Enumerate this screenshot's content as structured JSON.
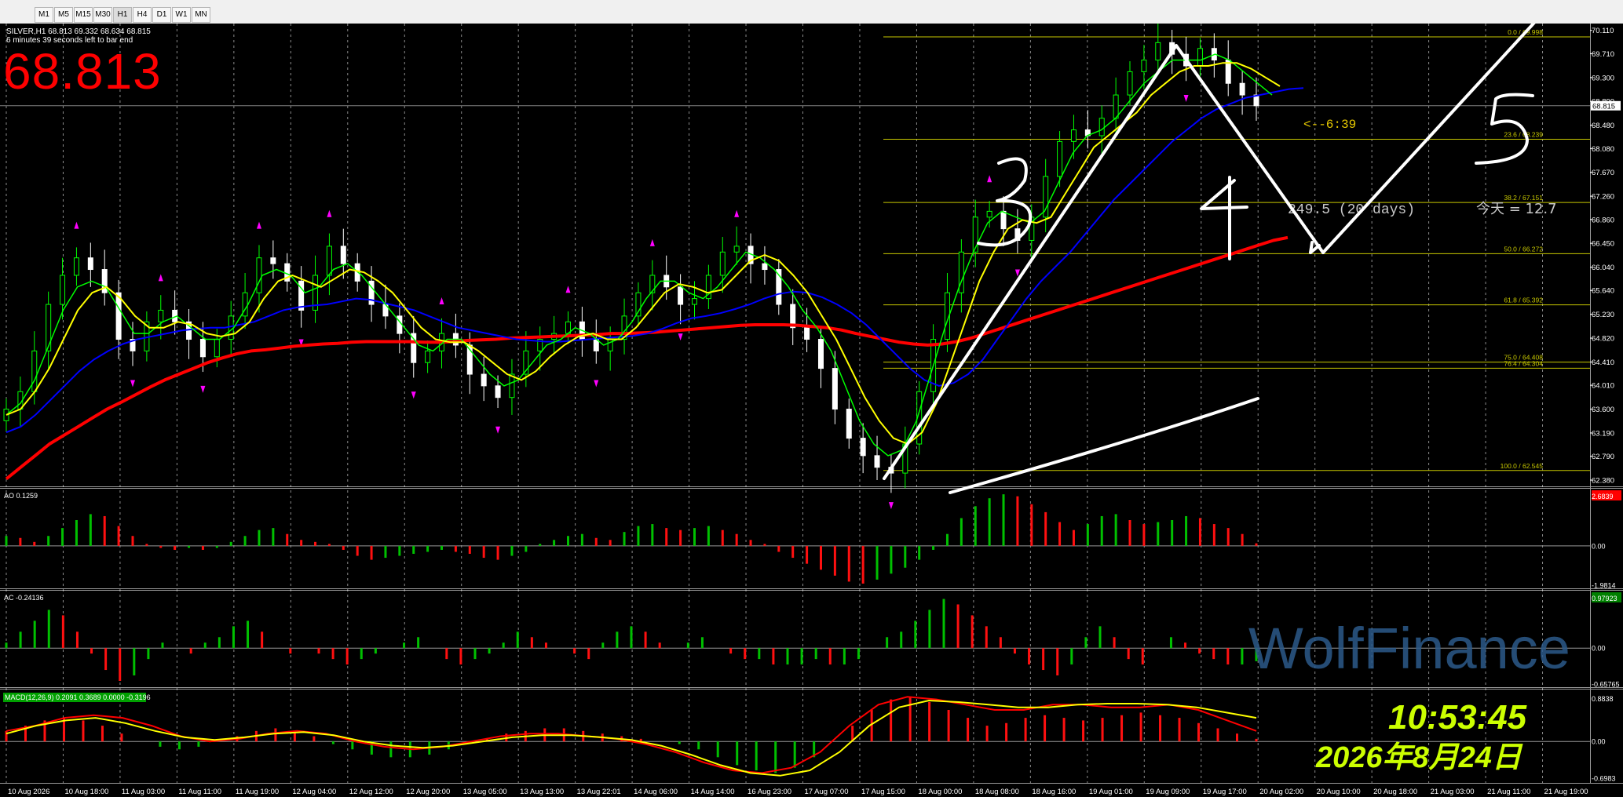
{
  "toolbar": {
    "timeframes": [
      "M1",
      "M5",
      "M15",
      "M30",
      "H1",
      "H4",
      "D1",
      "W1",
      "MN"
    ],
    "active_timeframe": "H1"
  },
  "header": {
    "symbol_line": "SILVER,H1  68.813 69.332 68.634 68.815",
    "timer_line": "6 minutes 39 seconds left to bar end",
    "big_price": "68.813",
    "countdown": "<--6:39",
    "range_text": "249.5  (20 days)",
    "today_text": "今天 = 12.7"
  },
  "colors": {
    "background": "#000000",
    "bull_candle": "#00ff00",
    "bear_candle": "#ffffff",
    "ma_red": "#ff0000",
    "ma_blue": "#0000ff",
    "ma_green": "#00ff00",
    "ma_yellow": "#ffff00",
    "fibo": "#c8c800",
    "fractal": "#ff00ff",
    "clock_text": "#ccff00"
  },
  "chart_data": [
    {
      "type": "candlestick",
      "title": "SILVER,H1",
      "ylim": [
        62.38,
        70.12
      ],
      "price_ticks": [
        "70.110",
        "69.710",
        "69.300",
        "68.890",
        "68.480",
        "68.080",
        "67.670",
        "67.260",
        "66.860",
        "66.450",
        "66.040",
        "65.640",
        "65.230",
        "64.820",
        "64.410",
        "64.010",
        "63.600",
        "63.190",
        "62.790",
        "62.380"
      ],
      "current_price": "68.815",
      "x_labels": [
        "10 Aug 2026",
        "10 Aug 18:00",
        "11 Aug 03:00",
        "11 Aug 11:00",
        "11 Aug 19:00",
        "12 Aug 04:00",
        "12 Aug 12:00",
        "12 Aug 20:00",
        "13 Aug 05:00",
        "13 Aug 13:00",
        "13 Aug 22:01",
        "14 Aug 06:00",
        "14 Aug 14:00",
        "16 Aug 23:00",
        "17 Aug 07:00",
        "17 Aug 15:00",
        "18 Aug 00:00",
        "18 Aug 08:00",
        "18 Aug 16:00",
        "19 Aug 01:00",
        "19 Aug 09:00",
        "19 Aug 17:00",
        "20 Aug 02:00",
        "20 Aug 10:00",
        "20 Aug 18:00",
        "21 Aug 03:00",
        "21 Aug 11:00",
        "21 Aug 19:00"
      ],
      "close": [
        63.6,
        63.9,
        64.6,
        65.4,
        65.9,
        66.2,
        66.0,
        65.6,
        64.8,
        64.6,
        65.1,
        65.3,
        65.1,
        64.8,
        64.5,
        64.8,
        65.2,
        65.6,
        66.2,
        66.1,
        65.8,
        65.3,
        65.9,
        66.4,
        66.1,
        65.8,
        65.4,
        65.2,
        64.9,
        64.4,
        64.6,
        64.9,
        64.7,
        64.2,
        64.0,
        63.8,
        64.2,
        64.6,
        64.8,
        64.9,
        65.1,
        64.8,
        64.6,
        64.8,
        65.2,
        65.6,
        65.9,
        65.7,
        65.4,
        65.5,
        65.9,
        66.3,
        66.4,
        66.1,
        66.0,
        65.4,
        65.0,
        64.8,
        64.3,
        63.6,
        63.1,
        62.8,
        62.6,
        62.5,
        63.0,
        63.9,
        64.8,
        65.6,
        66.3,
        66.9,
        67.0,
        66.7,
        66.5,
        66.9,
        67.6,
        68.2,
        68.4,
        68.3,
        68.6,
        69.0,
        69.4,
        69.6,
        69.9,
        69.7,
        69.5,
        69.8,
        69.6,
        69.2,
        69.0,
        68.815
      ],
      "ma_red": [
        62.4,
        62.6,
        62.8,
        63.0,
        63.15,
        63.3,
        63.45,
        63.6,
        63.72,
        63.85,
        63.98,
        64.1,
        64.2,
        64.3,
        64.4,
        64.48,
        64.55,
        64.6,
        64.62,
        64.65,
        64.68,
        64.7,
        64.72,
        64.73,
        64.75,
        64.76,
        64.76,
        64.76,
        64.76,
        64.75,
        64.75,
        64.76,
        64.78,
        64.79,
        64.8,
        64.82,
        64.83,
        64.84,
        64.85,
        64.86,
        64.87,
        64.88,
        64.9,
        64.9,
        64.91,
        64.92,
        64.94,
        64.96,
        64.98,
        65.0,
        65.02,
        65.04,
        65.05,
        65.05,
        65.05,
        65.04,
        65.02,
        65.0,
        64.96,
        64.9,
        64.85,
        64.8,
        64.75,
        64.72,
        64.7,
        64.72,
        64.76,
        64.82,
        64.9,
        64.98,
        65.06,
        65.14,
        65.22,
        65.3,
        65.38,
        65.46,
        65.54,
        65.62,
        65.7,
        65.78,
        65.86,
        65.94,
        66.02,
        66.1,
        66.18,
        66.26,
        66.34,
        66.42,
        66.5,
        66.55
      ],
      "ma_blue": [
        63.2,
        63.3,
        63.5,
        63.75,
        64.0,
        64.25,
        64.45,
        64.6,
        64.72,
        64.8,
        64.85,
        64.9,
        64.95,
        64.98,
        65.0,
        65.0,
        65.05,
        65.1,
        65.2,
        65.3,
        65.35,
        65.38,
        65.4,
        65.45,
        65.5,
        65.48,
        65.42,
        65.36,
        65.3,
        65.2,
        65.1,
        65.0,
        64.95,
        64.9,
        64.85,
        64.8,
        64.78,
        64.76,
        64.76,
        64.78,
        64.8,
        64.82,
        64.84,
        64.86,
        64.9,
        64.98,
        65.08,
        65.16,
        65.2,
        65.25,
        65.32,
        65.4,
        65.5,
        65.58,
        65.62,
        65.6,
        65.52,
        65.4,
        65.25,
        65.05,
        64.8,
        64.55,
        64.3,
        64.1,
        64.0,
        64.05,
        64.2,
        64.45,
        64.8,
        65.15,
        65.5,
        65.8,
        66.05,
        66.3,
        66.6,
        66.9,
        67.2,
        67.45,
        67.7,
        67.95,
        68.2,
        68.4,
        68.6,
        68.75,
        68.85,
        68.95,
        69.0,
        69.05,
        69.1,
        69.12
      ],
      "ma_green": [
        63.5,
        63.7,
        64.1,
        64.7,
        65.3,
        65.7,
        65.8,
        65.7,
        65.3,
        64.9,
        64.9,
        65.1,
        65.2,
        65.0,
        64.8,
        64.8,
        65.0,
        65.4,
        65.9,
        66.0,
        65.9,
        65.6,
        65.7,
        66.0,
        66.1,
        65.9,
        65.6,
        65.3,
        65.0,
        64.7,
        64.6,
        64.8,
        64.8,
        64.5,
        64.2,
        64.0,
        64.1,
        64.4,
        64.7,
        64.8,
        65.0,
        64.9,
        64.7,
        64.8,
        65.1,
        65.5,
        65.8,
        65.8,
        65.6,
        65.5,
        65.7,
        66.0,
        66.3,
        66.2,
        66.0,
        65.7,
        65.3,
        65.0,
        64.6,
        64.0,
        63.4,
        63.0,
        62.8,
        62.9,
        63.4,
        64.2,
        65.0,
        65.7,
        66.3,
        66.8,
        67.0,
        66.9,
        66.8,
        67.0,
        67.5,
        68.0,
        68.3,
        68.4,
        68.6,
        68.9,
        69.2,
        69.4,
        69.6,
        69.6,
        69.6,
        69.7,
        69.6,
        69.4,
        69.2,
        69.0
      ],
      "ma_yellow": [
        63.5,
        63.6,
        63.9,
        64.3,
        64.8,
        65.3,
        65.6,
        65.7,
        65.5,
        65.2,
        65.0,
        65.0,
        65.1,
        65.05,
        64.9,
        64.85,
        64.9,
        65.1,
        65.5,
        65.8,
        65.9,
        65.8,
        65.7,
        65.85,
        66.0,
        65.95,
        65.8,
        65.6,
        65.3,
        65.0,
        64.8,
        64.75,
        64.75,
        64.6,
        64.4,
        64.2,
        64.1,
        64.25,
        64.5,
        64.7,
        64.85,
        64.9,
        64.8,
        64.8,
        65.0,
        65.3,
        65.6,
        65.75,
        65.7,
        65.6,
        65.65,
        65.9,
        66.15,
        66.25,
        66.15,
        65.9,
        65.6,
        65.2,
        64.8,
        64.3,
        63.8,
        63.4,
        63.1,
        63.0,
        63.2,
        63.7,
        64.4,
        65.1,
        65.8,
        66.3,
        66.7,
        66.85,
        66.8,
        66.9,
        67.3,
        67.7,
        68.1,
        68.3,
        68.5,
        68.7,
        69.0,
        69.2,
        69.4,
        69.5,
        69.5,
        69.55,
        69.55,
        69.45,
        69.3,
        69.15
      ],
      "fibonacci": [
        {
          "level": "0.0",
          "price": "69.998"
        },
        {
          "level": "23.6",
          "price": "68.239"
        },
        {
          "level": "38.2",
          "price": "67.151"
        },
        {
          "level": "50.0",
          "price": "66.272"
        },
        {
          "level": "61.8",
          "price": "65.392"
        },
        {
          "level": "75.0",
          "price": "64.408"
        },
        {
          "level": "76.4",
          "price": "64.304"
        },
        {
          "level": "100.0",
          "price": "62.545"
        }
      ]
    },
    {
      "type": "bar",
      "title": "AO 0.1259",
      "ylim": [
        -1.9814,
        2.6839
      ],
      "tick_labels": [
        "2.6839",
        "0.00",
        "-1.9814"
      ],
      "values": [
        0.5,
        0.4,
        0.2,
        0.5,
        0.9,
        1.3,
        1.6,
        1.5,
        1.0,
        0.5,
        0.1,
        -0.1,
        -0.2,
        -0.1,
        -0.2,
        -0.1,
        0.2,
        0.5,
        0.8,
        0.9,
        0.6,
        0.3,
        0.2,
        0.1,
        -0.2,
        -0.5,
        -0.7,
        -0.6,
        -0.5,
        -0.4,
        -0.3,
        -0.2,
        -0.3,
        -0.4,
        -0.6,
        -0.7,
        -0.5,
        -0.3,
        0.1,
        0.3,
        0.5,
        0.6,
        0.4,
        0.3,
        0.7,
        1.0,
        1.1,
        0.9,
        0.8,
        0.9,
        1.0,
        0.8,
        0.6,
        0.3,
        0.1,
        -0.3,
        -0.6,
        -0.9,
        -1.2,
        -1.5,
        -1.8,
        -1.9,
        -1.7,
        -1.4,
        -1.1,
        -0.7,
        -0.2,
        0.6,
        1.4,
        2.0,
        2.4,
        2.6,
        2.5,
        2.1,
        1.7,
        1.2,
        0.8,
        1.1,
        1.5,
        1.6,
        1.3,
        1.1,
        1.2,
        1.3,
        1.5,
        1.4,
        1.1,
        0.9,
        0.6,
        0.13
      ]
    },
    {
      "type": "bar",
      "title": "AC -0.24136",
      "ylim": [
        -0.65765,
        0.97923
      ],
      "tick_labels": [
        "0.97923",
        "0.00",
        "-0.65765"
      ],
      "values": [
        0.1,
        0.3,
        0.5,
        0.7,
        0.6,
        0.3,
        -0.1,
        -0.4,
        -0.6,
        -0.5,
        -0.2,
        0.1,
        0.0,
        -0.1,
        0.1,
        0.2,
        0.4,
        0.5,
        0.3,
        0.0,
        -0.1,
        0.0,
        -0.1,
        -0.2,
        -0.3,
        -0.2,
        -0.1,
        0.0,
        0.1,
        0.2,
        0.0,
        -0.2,
        -0.3,
        -0.2,
        -0.1,
        0.1,
        0.3,
        0.2,
        0.1,
        0.0,
        -0.1,
        -0.2,
        0.1,
        0.3,
        0.4,
        0.3,
        0.1,
        0.0,
        0.1,
        0.2,
        0.0,
        -0.1,
        -0.2,
        -0.2,
        -0.3,
        -0.3,
        -0.3,
        -0.2,
        -0.3,
        -0.3,
        -0.2,
        0.0,
        0.2,
        0.3,
        0.5,
        0.7,
        0.9,
        0.8,
        0.6,
        0.4,
        0.2,
        -0.1,
        -0.3,
        -0.4,
        -0.5,
        -0.3,
        0.2,
        0.4,
        0.2,
        -0.2,
        -0.3,
        0.0,
        0.2,
        0.1,
        -0.1,
        -0.2,
        -0.3,
        -0.3,
        -0.24
      ]
    },
    {
      "type": "line",
      "title": "MACD(12,26,9) 0.2091 0.3689 0.0000 -0.3196",
      "ylim": [
        -0.6983,
        0.8838
      ],
      "tick_labels": [
        "0.8838",
        "0.00",
        "-0.6983"
      ],
      "hist": [
        0.2,
        0.3,
        0.4,
        0.45,
        0.4,
        0.3,
        0.15,
        0.0,
        -0.1,
        -0.15,
        -0.1,
        0.0,
        0.1,
        0.2,
        0.25,
        0.2,
        0.1,
        -0.05,
        -0.15,
        -0.25,
        -0.3,
        -0.3,
        -0.25,
        -0.15,
        -0.05,
        0.05,
        0.15,
        0.2,
        0.25,
        0.25,
        0.2,
        0.15,
        0.1,
        0.05,
        0.0,
        -0.05,
        -0.15,
        -0.3,
        -0.45,
        -0.55,
        -0.6,
        -0.5,
        -0.3,
        0.0,
        0.3,
        0.6,
        0.8,
        0.85,
        0.75,
        0.6,
        0.45,
        0.3,
        0.35,
        0.45,
        0.5,
        0.45,
        0.4,
        0.45,
        0.5,
        0.55,
        0.5,
        0.45,
        0.35,
        0.25,
        0.15,
        0.05
      ],
      "macd_line": [
        0.2,
        0.3,
        0.45,
        0.5,
        0.45,
        0.3,
        0.1,
        0.0,
        0.05,
        0.15,
        0.2,
        0.15,
        0.0,
        -0.1,
        -0.15,
        -0.1,
        0.0,
        0.1,
        0.15,
        0.15,
        0.1,
        0.05,
        -0.05,
        -0.2,
        -0.4,
        -0.55,
        -0.6,
        -0.5,
        -0.2,
        0.3,
        0.7,
        0.85,
        0.8,
        0.7,
        0.6,
        0.6,
        0.7,
        0.7,
        0.65,
        0.65,
        0.7,
        0.6,
        0.4,
        0.2
      ],
      "signal_line": [
        0.15,
        0.3,
        0.4,
        0.45,
        0.35,
        0.2,
        0.08,
        0.03,
        0.08,
        0.15,
        0.18,
        0.12,
        0.0,
        -0.08,
        -0.12,
        -0.08,
        0.0,
        0.08,
        0.12,
        0.12,
        0.08,
        0.03,
        -0.08,
        -0.25,
        -0.45,
        -0.6,
        -0.65,
        -0.55,
        -0.2,
        0.3,
        0.65,
        0.78,
        0.75,
        0.7,
        0.65,
        0.65,
        0.7,
        0.72,
        0.72,
        0.7,
        0.65,
        0.55,
        0.45
      ]
    }
  ],
  "annotations": [
    "3",
    "4",
    "5"
  ],
  "watermark": {
    "brand": "WolfFinance",
    "clock": "10:53:45",
    "date": "2026年8月24日"
  }
}
